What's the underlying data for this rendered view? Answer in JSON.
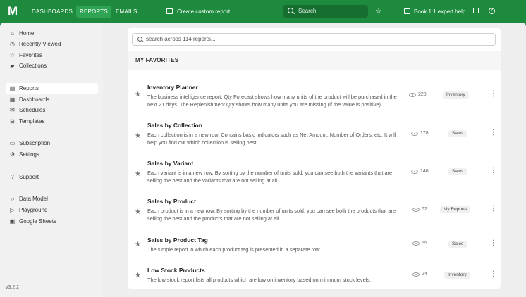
{
  "topbar": {
    "logo": "M",
    "tabs": [
      {
        "label": "DASHBOARDS"
      },
      {
        "label": "REPORTS"
      },
      {
        "label": "EMAILS"
      }
    ],
    "create_label": "Create custom report",
    "search_placeholder": "Search",
    "expert_label": "Book 1:1 expert help",
    "brand_color": "#1e8a3e"
  },
  "sidebar": {
    "items": [
      {
        "label": "Home",
        "icon": "home-icon"
      },
      {
        "label": "Recently Viewed",
        "icon": "clock-icon"
      },
      {
        "label": "Favorites",
        "icon": "star-icon"
      },
      {
        "label": "Collections",
        "icon": "folder-icon"
      },
      {
        "label": "Reports",
        "icon": "report-icon"
      },
      {
        "label": "Dashboards",
        "icon": "grid-icon"
      },
      {
        "label": "Schedules",
        "icon": "mail-icon"
      },
      {
        "label": "Templates",
        "icon": "template-icon"
      },
      {
        "label": "Subscription",
        "icon": "card-icon"
      },
      {
        "label": "Settings",
        "icon": "gear-icon"
      },
      {
        "label": "Support",
        "icon": "help-icon"
      },
      {
        "label": "Data Model",
        "icon": "code-icon"
      },
      {
        "label": "Playground",
        "icon": "play-icon"
      },
      {
        "label": "Google Sheets",
        "icon": "sheets-icon"
      }
    ],
    "version": "v3.2.2"
  },
  "main": {
    "search_placeholder": "search across 114 reports...",
    "section_title": "MY FAVORITES",
    "reports": [
      {
        "title": "Inventory Planner",
        "description": "The business intelligence report. Qty Forecast shows how many units of the product will be purchased in the next 21 days. The Replenishment Qty shows how many units you are missing (if the value is positive).",
        "views": "228",
        "tag": "Inventory"
      },
      {
        "title": "Sales by Collection",
        "description": "Each collection is in a new row. Contains basic indicators such as Net Amount, Number of Orders, etc. It will help you find out which collection is selling best.",
        "views": "178",
        "tag": "Sales"
      },
      {
        "title": "Sales by Variant",
        "description": "Each variant is in a new row. By sorting by the number of units sold, you can see both the variants that are selling the best and the variants that are not selling at all.",
        "views": "146",
        "tag": "Sales"
      },
      {
        "title": "Sales by Product",
        "description": "Each product is in a new row. By sorting by the number of units sold, you can see both the products that are selling the best and the products that are not selling at all.",
        "views": "62",
        "tag": "My Reports"
      },
      {
        "title": "Sales by Product Tag",
        "description": "The simple report in which each product tag is presented in a separate row.",
        "views": "55",
        "tag": "Sales"
      },
      {
        "title": "Low Stock Products",
        "description": "The low stock report lists all products which are low on inventory based on minimum stock levels.",
        "views": "24",
        "tag": "Inventory"
      }
    ]
  }
}
